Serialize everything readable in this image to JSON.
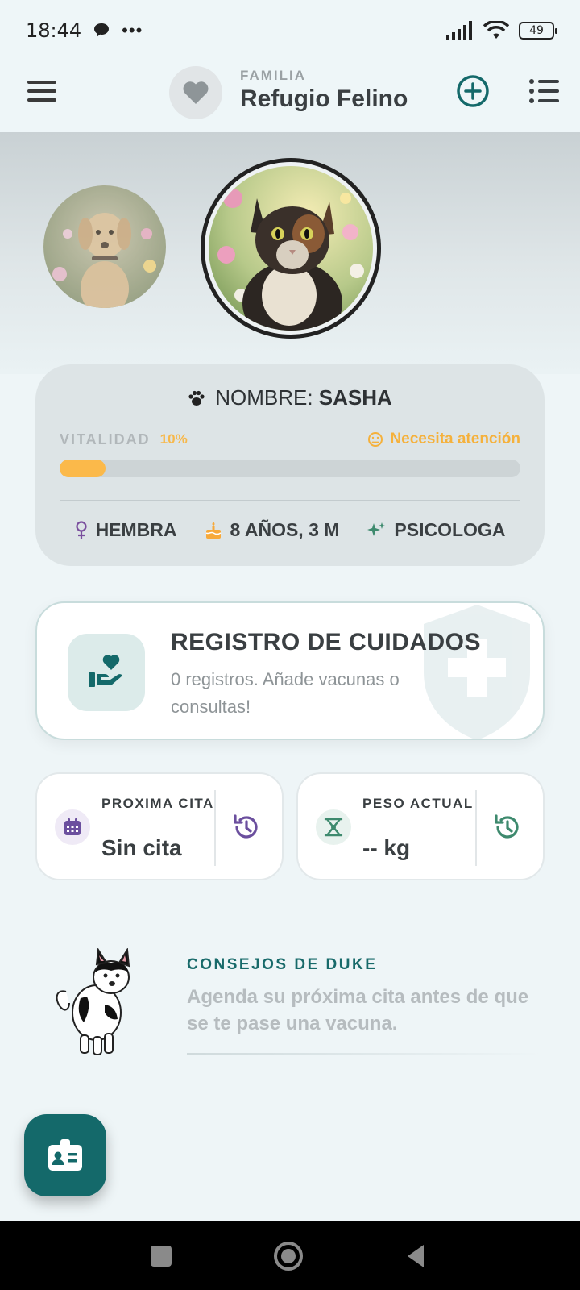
{
  "status_bar": {
    "time": "18:44",
    "battery": "49"
  },
  "header": {
    "family_label": "FAMILIA",
    "family_name": "Refugio Felino"
  },
  "pet": {
    "name_label": "NOMBRE:",
    "name": "SASHA",
    "vitality_label": "VITALIDAD",
    "vitality_percent": "10%",
    "vitality_fraction": 0.1,
    "vitality_status": "Necesita atención",
    "sex": "HEMBRA",
    "age": "8 AÑOS, 3 M",
    "personality": "PSICOLOGA"
  },
  "care": {
    "title": "REGISTRO DE CUIDADOS",
    "description": "0 registros. Añade vacunas o consultas!"
  },
  "next_appointment": {
    "label": "PROXIMA CITA",
    "value": "Sin cita"
  },
  "weight": {
    "label": "PESO ACTUAL",
    "value": "-- kg"
  },
  "tips": {
    "title": "CONSEJOS DE DUKE",
    "text": "Agenda su próxima cita antes de que se te pase una vacuna."
  },
  "colors": {
    "brand": "#14696a",
    "warning": "#f5b13c",
    "purple": "#6b4f9e",
    "green": "#3e8a6e"
  },
  "icons": {
    "header": [
      "menu-icon",
      "heart-icon",
      "add-circle-icon",
      "list-icon"
    ],
    "cards": [
      "paw-icon",
      "female-icon",
      "cake-icon",
      "sparkle-icon",
      "hand-heart-icon",
      "shield-plus-icon",
      "calendar-icon",
      "scale-icon",
      "history-icon",
      "id-card-icon"
    ]
  }
}
